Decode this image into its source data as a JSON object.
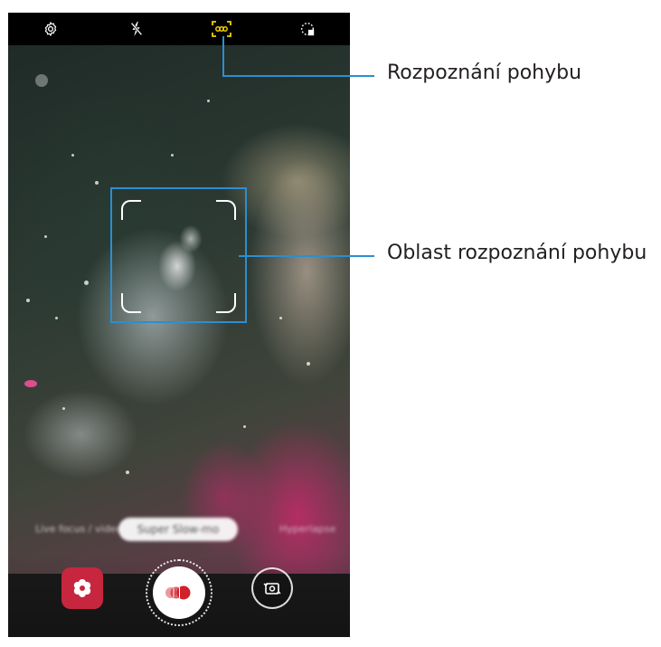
{
  "top_bar": {
    "icons": [
      "settings-icon",
      "flash-off-icon",
      "motion-detection-icon",
      "ratio-icon"
    ]
  },
  "viewfinder": {
    "mode_options": {
      "left": "Live focus / video",
      "selected": "Super Slow-mo",
      "right": "Hyperlapse"
    }
  },
  "bottom_controls": {
    "gallery_icon": "flower-icon",
    "shutter_icon": "super-slow-mo-record-icon",
    "switch_icon": "switch-camera-icon"
  },
  "callouts": {
    "motion_detection": "Rozpoznání pohybu",
    "motion_detection_area": "Oblast rozpoznání pohybu"
  },
  "colors": {
    "callout_line": "#2d8ed0",
    "motion_icon_active": "#f0d000",
    "gallery_bg": "#c7263f",
    "record_dots": "#d0202a"
  }
}
